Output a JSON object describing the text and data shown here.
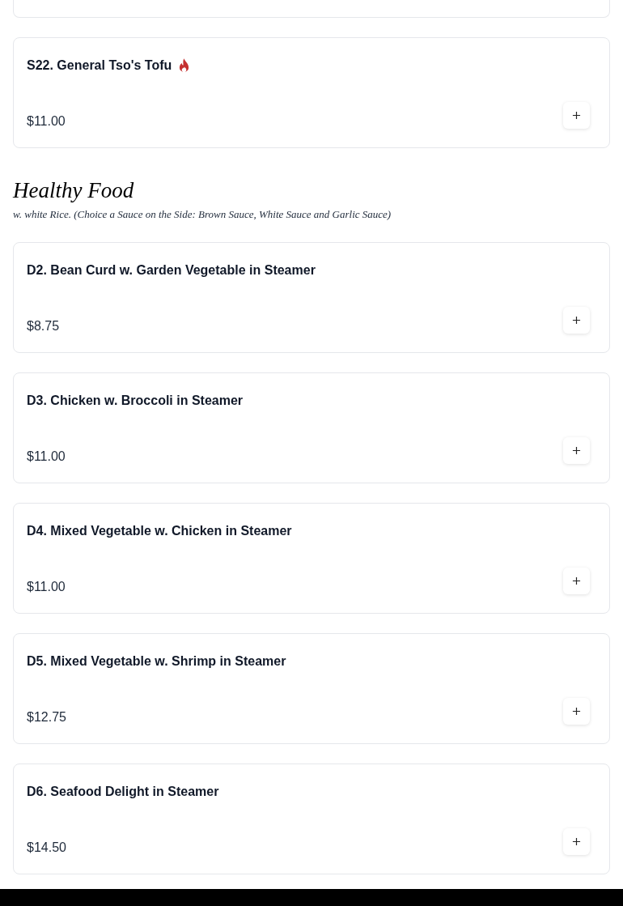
{
  "sections": [
    {
      "items": [
        {
          "name": "S22. General Tso's Tofu",
          "spicy": true,
          "price": "$11.00"
        }
      ]
    },
    {
      "title": "Healthy Food",
      "subtitle": "w. white Rice. (Choice a Sauce on the Side: Brown Sauce, White Sauce and Garlic Sauce)",
      "items": [
        {
          "name": "D2. Bean Curd w. Garden Vegetable in Steamer",
          "spicy": false,
          "price": "$8.75"
        },
        {
          "name": "D3. Chicken w. Broccoli in Steamer",
          "spicy": false,
          "price": "$11.00"
        },
        {
          "name": "D4. Mixed Vegetable w. Chicken in Steamer",
          "spicy": false,
          "price": "$11.00"
        },
        {
          "name": "D5. Mixed Vegetable w. Shrimp in Steamer",
          "spicy": false,
          "price": "$12.75"
        },
        {
          "name": "D6. Seafood Delight in Steamer",
          "spicy": false,
          "price": "$14.50"
        }
      ]
    }
  ]
}
